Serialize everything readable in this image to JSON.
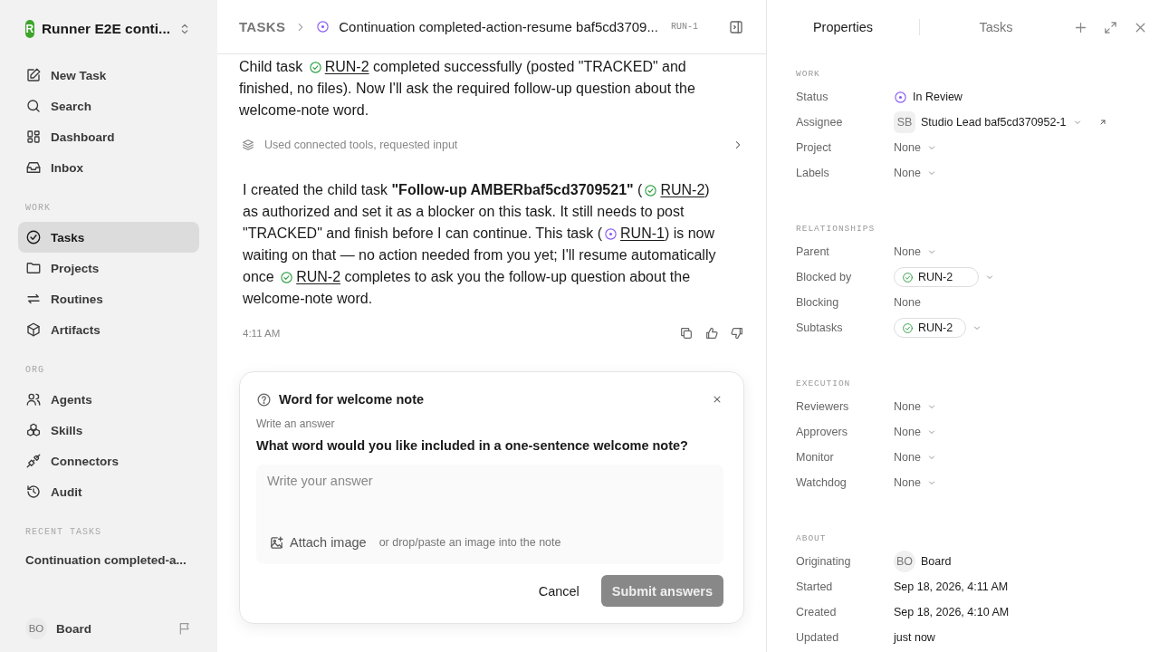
{
  "workspace": {
    "initial": "R",
    "name": "Runner E2E conti..."
  },
  "nav": [
    {
      "label": "New Task",
      "selected": false
    },
    {
      "label": "Search",
      "selected": false
    },
    {
      "label": "Dashboard",
      "selected": false
    },
    {
      "label": "Inbox",
      "selected": false
    }
  ],
  "sidebar_sections": [
    {
      "title": "WORK",
      "items": [
        {
          "label": "Tasks",
          "selected": true
        },
        {
          "label": "Projects",
          "selected": false
        },
        {
          "label": "Routines",
          "selected": false
        },
        {
          "label": "Artifacts",
          "selected": false
        }
      ]
    },
    {
      "title": "ORG",
      "items": [
        {
          "label": "Agents",
          "selected": false
        },
        {
          "label": "Skills",
          "selected": false
        },
        {
          "label": "Connectors",
          "selected": false
        },
        {
          "label": "Audit",
          "selected": false
        }
      ]
    }
  ],
  "recent_tasks": {
    "title": "RECENT TASKS",
    "items": [
      "Continuation completed-a..."
    ]
  },
  "user": {
    "initials": "BO",
    "name": "Board"
  },
  "breadcrumb": {
    "root": "TASKS",
    "done": false,
    "title": "Continuation completed-action-resume baf5cd3709...",
    "id": "RUN-1"
  },
  "messages": [
    {
      "segments": [
        {
          "text": "Child task "
        },
        {
          "ref": "RUN-2",
          "done": true
        },
        {
          "text": " completed successfully (posted \"TRACKED\" and finished, no files). Now I'll ask the required follow-up question about the welcome-note word."
        }
      ]
    },
    {
      "segments": [
        {
          "text": "I created the child task **\"Follow-up AMBERbaf5cd3709521\"** ("
        },
        {
          "ref": "RUN-2",
          "done": true
        },
        {
          "text": ") as authorized and set it as a blocker on this task. It still needs to post \"TRACKED\" and finish before I can continue. This task ("
        },
        {
          "ref": "RUN-1",
          "done": false
        },
        {
          "text": ") is now waiting on that — no action needed from you yet; I'll resume automatically once "
        },
        {
          "ref": "RUN-2",
          "done": true
        },
        {
          "text": " completes to ask you the follow-up question about the welcome-note word."
        }
      ]
    }
  ],
  "tool_summary": "Used connected tools, requested input",
  "timestamp": "4:11 AM",
  "question": {
    "title": "Word for welcome note",
    "subtitle": "Write an answer",
    "prompt": "What word would you like included in a one-sentence welcome note?",
    "placeholder": "Write your answer",
    "attach": "Attach image",
    "attach_hint": "or drop/paste an image into the note",
    "cancel": "Cancel",
    "submit": "Submit answers",
    "submit_disabled": true
  },
  "panel": {
    "tabs": [
      {
        "label": "Properties",
        "selected": true
      },
      {
        "label": "Tasks",
        "selected": false
      }
    ],
    "sections": [
      {
        "title": "WORK",
        "rows": [
          {
            "label": "Status",
            "kind": "status",
            "done": false,
            "value": "In Review",
            "dropdown": false
          },
          {
            "label": "Assignee",
            "kind": "person",
            "initials": "SB",
            "value": "Studio Lead baf5cd370952-1",
            "dropdown": true,
            "link": true
          },
          {
            "label": "Project",
            "kind": "plain",
            "value": "None",
            "dropdown": true
          },
          {
            "label": "Labels",
            "kind": "plain",
            "value": "None",
            "dropdown": true
          }
        ]
      },
      {
        "title": "RELATIONSHIPS",
        "rows": [
          {
            "label": "Parent",
            "kind": "plain",
            "value": "None",
            "dropdown": true
          },
          {
            "label": "Blocked by",
            "kind": "chip",
            "done": true,
            "value": "RUN-2",
            "dropdown": true
          },
          {
            "label": "Blocking",
            "kind": "plain",
            "value": "None",
            "dropdown": false
          },
          {
            "label": "Subtasks",
            "kind": "chip",
            "done": true,
            "value": "RUN-2",
            "dropdown": true
          }
        ]
      },
      {
        "title": "EXECUTION",
        "rows": [
          {
            "label": "Reviewers",
            "kind": "plain",
            "value": "None",
            "dropdown": true
          },
          {
            "label": "Approvers",
            "kind": "plain",
            "value": "None",
            "dropdown": true
          },
          {
            "label": "Monitor",
            "kind": "plain",
            "value": "None",
            "dropdown": true
          },
          {
            "label": "Watchdog",
            "kind": "plain",
            "value": "None",
            "dropdown": true
          }
        ]
      },
      {
        "title": "ABOUT",
        "rows": [
          {
            "label": "Originating",
            "kind": "person",
            "initials": "BO",
            "value": "Board",
            "dropdown": false,
            "link": false
          },
          {
            "label": "Started",
            "kind": "date",
            "value": "Sep 18, 2026, 4:11 AM",
            "dropdown": false
          },
          {
            "label": "Created",
            "kind": "date",
            "value": "Sep 18, 2026, 4:10 AM",
            "dropdown": false
          },
          {
            "label": "Updated",
            "kind": "date",
            "value": "just now",
            "dropdown": false
          }
        ]
      }
    ]
  }
}
